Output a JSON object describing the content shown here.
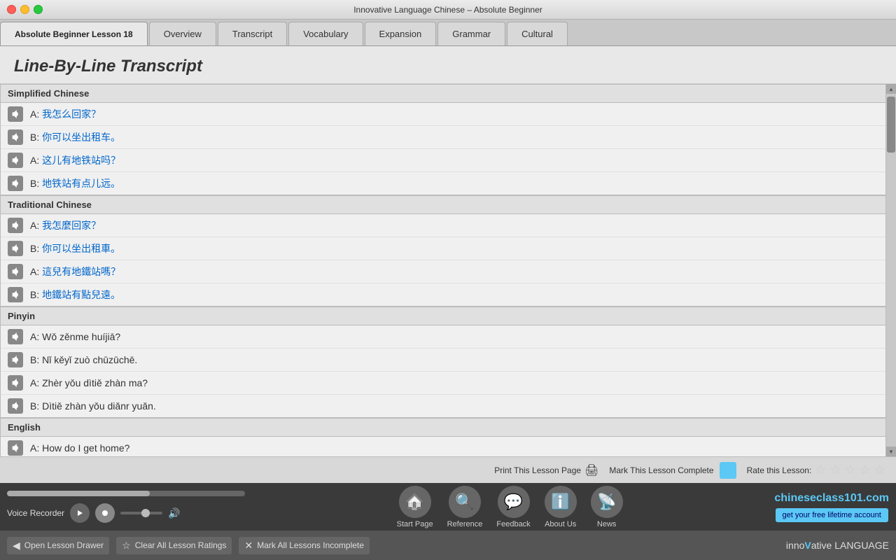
{
  "window": {
    "title": "Innovative Language Chinese – Absolute Beginner"
  },
  "tabs": {
    "lesson": "Absolute Beginner Lesson 18",
    "items": [
      "Overview",
      "Transcript",
      "Vocabulary",
      "Expansion",
      "Grammar",
      "Cultural"
    ],
    "active": "Transcript"
  },
  "content": {
    "title": "Line-By-Line Transcript",
    "sections": [
      {
        "header": "Simplified Chinese",
        "lines": [
          {
            "label": "A: ",
            "text": "我怎么回家？"
          },
          {
            "label": "B: ",
            "text": "你可以坐出租车。"
          },
          {
            "label": "A: ",
            "text": "这儿有地铁站吗？"
          },
          {
            "label": "B: ",
            "text": "地铁站有点儿远。"
          }
        ]
      },
      {
        "header": "Traditional Chinese",
        "lines": [
          {
            "label": "A: ",
            "text": "我怎麼回家？"
          },
          {
            "label": "B: ",
            "text": "你可以坐出租車。"
          },
          {
            "label": "A: ",
            "text": "這兒有地鐵站嗎？"
          },
          {
            "label": "B: ",
            "text": "地鐵站有點兒遠。"
          }
        ]
      },
      {
        "header": "Pinyin",
        "lines": [
          {
            "label": "A: ",
            "text": "Wǒ zěnme huíjiā?"
          },
          {
            "label": "B: ",
            "text": "Nǐ kěyǐ zuò chūzūchē."
          },
          {
            "label": "A: ",
            "text": "Zhèr yǒu dìtiě zhàn ma?"
          },
          {
            "label": "B: ",
            "text": "Dìtiě zhàn yǒu diǎnr yuǎn."
          }
        ]
      },
      {
        "header": "English",
        "lines": [
          {
            "label": "A: ",
            "text": "How do I get home?"
          }
        ]
      }
    ]
  },
  "bottom_bar": {
    "print_label": "Print This Lesson Page",
    "mark_complete_label": "Mark This Lesson Complete",
    "rate_label": "Rate this Lesson:",
    "stars": [
      "☆",
      "☆",
      "☆",
      "☆",
      "☆"
    ]
  },
  "player": {
    "voice_recorder_label": "Voice Recorder"
  },
  "nav_icons": [
    {
      "name": "start-page",
      "label": "Start Page",
      "icon": "🏠"
    },
    {
      "name": "reference",
      "label": "Reference",
      "icon": "🔍"
    },
    {
      "name": "feedback",
      "label": "Feedback",
      "icon": "💬"
    },
    {
      "name": "about-us",
      "label": "About Us",
      "icon": "ℹ"
    },
    {
      "name": "news",
      "label": "News",
      "icon": "📡"
    }
  ],
  "branding": {
    "name_prefix": "chinese",
    "name_suffix": "class101.com",
    "free_account": "get your free lifetime account"
  },
  "footer": {
    "open_drawer": "Open Lesson Drawer",
    "clear_ratings": "Clear All Lesson Ratings",
    "mark_incomplete": "Mark All Lessons Incomplete",
    "logo_prefix": "inno",
    "logo_highlight": "V",
    "logo_suffix": "ative LANGUAGE"
  }
}
